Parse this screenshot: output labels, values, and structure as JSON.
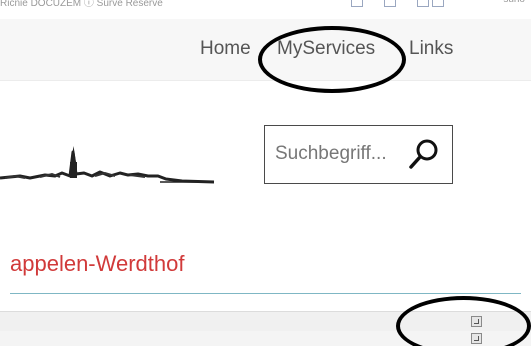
{
  "top_strip": {
    "left_cut_text": "Ricnie DOCUZEM  ⓘ  Surve Reserve",
    "right_cut_text": "suno"
  },
  "nav": {
    "items": [
      {
        "label": "Home"
      },
      {
        "label": "MyServices"
      },
      {
        "label": "Links"
      }
    ]
  },
  "search": {
    "placeholder": "Suchbegriff...",
    "value": ""
  },
  "page": {
    "title": "appelen-Werdthof"
  },
  "colors": {
    "title": "#d13a3a",
    "rule": "#7fb7c4",
    "nav_text": "#555555",
    "annotation": "#000000"
  },
  "icons": {
    "search": "magnifier-icon",
    "expand": "expand-icon"
  }
}
